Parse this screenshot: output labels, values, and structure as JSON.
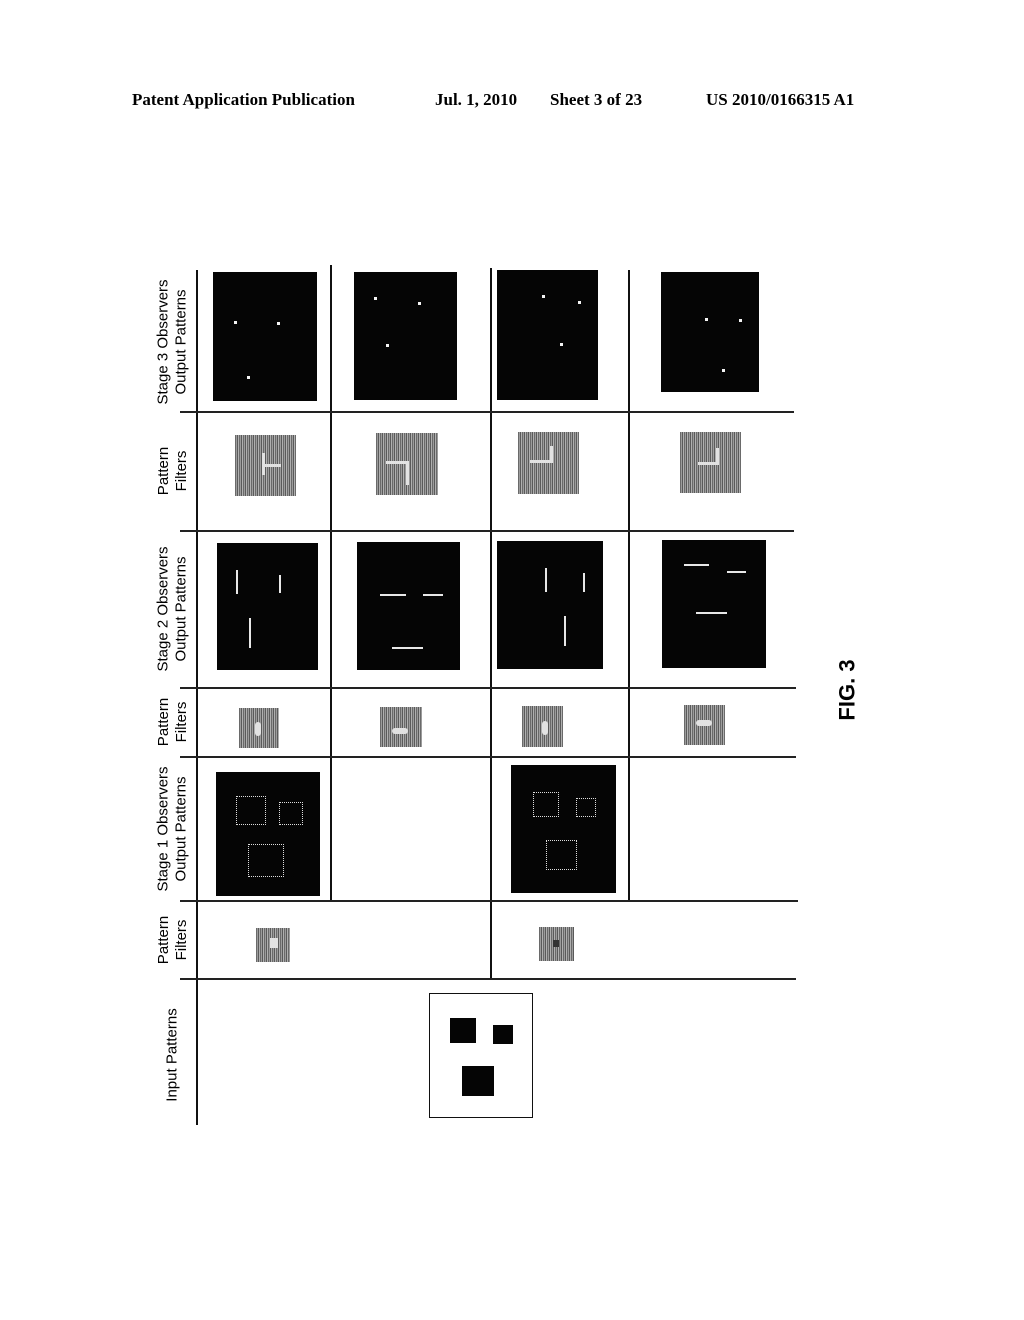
{
  "header": {
    "publication": "Patent Application Publication",
    "date": "Jul. 1, 2010",
    "sheet": "Sheet 3 of 23",
    "number": "US 2010/0166315 A1"
  },
  "figure": {
    "label": "FIG. 3",
    "row_labels": [
      "Stage 3 Observers\nOutput Patterns",
      "Pattern\nFilters",
      "Stage 2 Observers\nOutput Patterns",
      "Pattern\nFilters",
      "Stage 1 Observers\nOutput Patterns",
      "Pattern\nFilters",
      "Input Patterns"
    ],
    "columns": [
      {
        "stage3_output": "three dots (left-top, right-top, bottom)",
        "stage3_filter": "corner filter",
        "stage2_output": "vertical line segments",
        "stage2_filter": "vertical blob",
        "stage1_output": "three square outlines",
        "stage1_filter": "square corner filter"
      },
      {
        "stage3_output": "three dots",
        "stage3_filter": "corner filter",
        "stage2_output": "horizontal line segments",
        "stage2_filter": "horizontal blob",
        "stage1_output": "",
        "stage1_filter": ""
      },
      {
        "stage3_output": "three dots",
        "stage3_filter": "corner filter",
        "stage2_output": "vertical line segments",
        "stage2_filter": "vertical blob",
        "stage1_output": "three square outlines",
        "stage1_filter": "square corner filter"
      },
      {
        "stage3_output": "three dots",
        "stage3_filter": "corner filter",
        "stage2_output": "horizontal line segments",
        "stage2_filter": "horizontal blob",
        "stage1_output": "",
        "stage1_filter": ""
      }
    ],
    "input_pattern": "three black squares on white"
  }
}
